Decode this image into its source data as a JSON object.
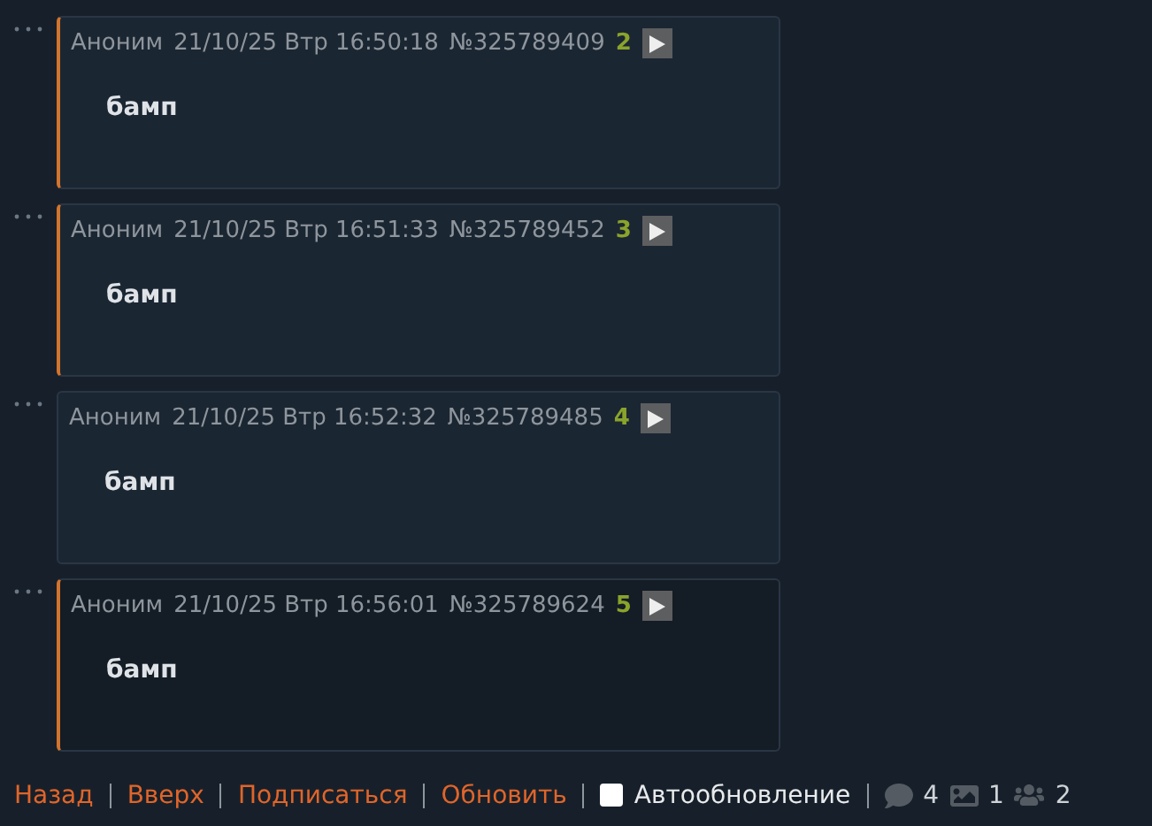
{
  "posts": [
    {
      "author": "Аноним",
      "date": "21/10/25 Втр 16:50:18",
      "number": "№325789409",
      "index": "2",
      "text": "бамп",
      "marked": true,
      "highlighted": false
    },
    {
      "author": "Аноним",
      "date": "21/10/25 Втр 16:51:33",
      "number": "№325789452",
      "index": "3",
      "text": "бамп",
      "marked": true,
      "highlighted": false
    },
    {
      "author": "Аноним",
      "date": "21/10/25 Втр 16:52:32",
      "number": "№325789485",
      "index": "4",
      "text": "бамп",
      "marked": false,
      "highlighted": false
    },
    {
      "author": "Аноним",
      "date": "21/10/25 Втр 16:56:01",
      "number": "№325789624",
      "index": "5",
      "text": "бамп",
      "marked": true,
      "highlighted": true
    }
  ],
  "footer": {
    "links": [
      "Назад",
      "Вверх",
      "Подписаться",
      "Обновить"
    ],
    "autoupdate": {
      "label": "Автообновление",
      "checked": false
    },
    "stats": [
      {
        "kind": "posts",
        "value": "4"
      },
      {
        "kind": "images",
        "value": "1"
      },
      {
        "kind": "users",
        "value": "2"
      }
    ]
  }
}
